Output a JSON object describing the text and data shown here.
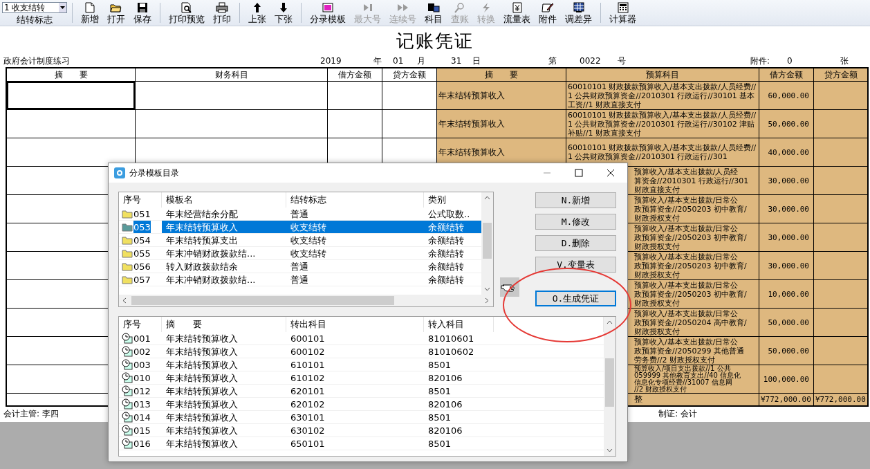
{
  "toolbar": {
    "combo": {
      "value": "1 收支结转",
      "label": "结转标志"
    },
    "groups": [
      [
        {
          "label": "新增",
          "disabled": false
        },
        {
          "label": "打开",
          "disabled": false
        },
        {
          "label": "保存",
          "disabled": false
        }
      ],
      [
        {
          "label": "打印预览",
          "disabled": false
        },
        {
          "label": "打印",
          "disabled": false
        }
      ],
      [
        {
          "label": "上张",
          "disabled": false
        },
        {
          "label": "下张",
          "disabled": false
        }
      ],
      [
        {
          "label": "分录模板",
          "disabled": false
        },
        {
          "label": "最大号",
          "disabled": true
        },
        {
          "label": "连续号",
          "disabled": true
        },
        {
          "label": "科目",
          "disabled": false
        },
        {
          "label": "查账",
          "disabled": true
        },
        {
          "label": "转换",
          "disabled": true
        },
        {
          "label": "流量表",
          "disabled": false
        },
        {
          "label": "附件",
          "disabled": false
        },
        {
          "label": "调差异",
          "disabled": false
        }
      ],
      [
        {
          "label": "计算器",
          "disabled": false
        }
      ]
    ]
  },
  "voucher": {
    "title": "记账凭证",
    "info": [
      "政府会计制度练习",
      "2019",
      "年",
      "01",
      "月",
      "31",
      "日",
      "第",
      "0022",
      "号",
      "附件:",
      "0",
      "张"
    ],
    "columns": [
      "摘　　要",
      "财务科目",
      "借方金额",
      "贷方金额",
      "摘　　要",
      "预算科目",
      "借方金额",
      "贷方金额"
    ],
    "rows": [
      {
        "focused": true,
        "summary": "年末结转预算收入",
        "budget": "60010101 财政拨款预算收入/基本支出拨款/人员经费//1 公共财政预算资金//2010301 行政运行//30101 基本工资//1 财政直接支付",
        "debit": "60,000.00"
      },
      {
        "focused": false,
        "summary": "年末结转预算收入",
        "budget": "60010101 财政拨款预算收入/基本支出拨款/人员经费//1 公共财政预算资金//2010301 行政运行//30102 津贴补贴//1 财政直接支付",
        "debit": "50,000.00"
      },
      {
        "focused": false,
        "summary": "年末结转预算收入",
        "budget": "60010101 财政拨款预算收入/基本支出拨款/人员经费//1 公共财政预算资金//2010301 行政运行//301",
        "debit": "40,000.00"
      },
      {
        "focused": false,
        "budget_fragments": [
          "预算收入/基本支出拨款/人员经",
          "算资金//2010301 行政运行//301",
          "财政直接支付"
        ],
        "debit": "30,000.00"
      },
      {
        "focused": false,
        "budget_fragments": [
          "预算收入/基本支出拨款/日常公",
          "政预算资金//2050203 初中教育/",
          "财政授权支付"
        ],
        "debit": "30,000.00"
      },
      {
        "focused": false,
        "budget_fragments": [
          "预算收入/基本支出拨款/日常公",
          "政预算资金//2050203 初中教育/",
          "财政授权支付"
        ],
        "debit": "30,000.00"
      },
      {
        "focused": false,
        "budget_fragments": [
          "预算收入/基本支出拨款/日常公",
          "政预算资金//2050203 初中教育/",
          "财政授权支付"
        ],
        "debit": "30,000.00"
      },
      {
        "focused": false,
        "budget_fragments": [
          "预算收入/基本支出拨款/日常公",
          "政预算资金//2050203 初中教育/",
          "财政授权支付"
        ],
        "debit": "10,000.00"
      },
      {
        "focused": false,
        "budget_fragments": [
          "预算收入/基本支出拨款/日常公",
          "政预算资金//2050204 高中教育/",
          "财政授权支付"
        ],
        "debit": "50,000.00"
      },
      {
        "focused": false,
        "budget_fragments": [
          "预算收入/基本支出拨款/日常公",
          "政预算资金//2050299 其他普通",
          "劳务费//2 财政授权支付"
        ],
        "debit": "50,000.00"
      },
      {
        "focused": false,
        "budget_fragments": [
          "预算收入/项目支出拨款//1 公共",
          "059999 其他教育支出//40 信息化",
          "信息化专项经费//31007 信息网",
          "//2 财政授权支付"
        ],
        "debit": "100,000.00"
      }
    ],
    "total": {
      "label": "整",
      "debit": "¥772,000.00",
      "credit": "¥772,000.00"
    },
    "footer": {
      "supervisor": "会计主管: 李四",
      "maker": "制证: 会计"
    }
  },
  "dialog": {
    "title": "分录模板目录",
    "templates": {
      "columns": [
        "序号",
        "模板名",
        "结转标志",
        "类别"
      ],
      "rows": [
        {
          "no": "051",
          "name": "年末经营结余分配",
          "flag": "普通",
          "category": "公式取数..",
          "selected": false
        },
        {
          "no": "053",
          "name": "年末结转预算收入",
          "flag": "收支结转",
          "category": "余额结转",
          "selected": true
        },
        {
          "no": "054",
          "name": "年末结转预算支出",
          "flag": "收支结转",
          "category": "余额结转",
          "selected": false
        },
        {
          "no": "055",
          "name": "年末冲销财政拨款结...",
          "flag": "收支结转",
          "category": "余额结转",
          "selected": false
        },
        {
          "no": "056",
          "name": "转入财政拨款结余",
          "flag": "普通",
          "category": "余额结转",
          "selected": false
        },
        {
          "no": "057",
          "name": "年末冲销财政拨款结...",
          "flag": "普通",
          "category": "余额结转",
          "selected": false
        }
      ]
    },
    "buttons": [
      {
        "label": "N.新增",
        "focused": false
      },
      {
        "label": "M.修改",
        "focused": false
      },
      {
        "label": "D.删除",
        "focused": false
      },
      {
        "label": "V.变量表",
        "focused": false
      },
      {
        "label": "O.生成凭证",
        "focused": true
      }
    ],
    "entries": {
      "columns": [
        "序号",
        "摘　　要",
        "转出科目",
        "转入科目"
      ],
      "rows": [
        {
          "no": "001",
          "summary": "年末结转预算收入",
          "out": "600101",
          "in": "81010601"
        },
        {
          "no": "002",
          "summary": "年末结转预算收入",
          "out": "600102",
          "in": "81010602"
        },
        {
          "no": "003",
          "summary": "年末结转预算收入",
          "out": "610101",
          "in": "8501"
        },
        {
          "no": "010",
          "summary": "年末结转预算收入",
          "out": "610102",
          "in": "820106"
        },
        {
          "no": "012",
          "summary": "年末结转预算收入",
          "out": "620101",
          "in": "8501"
        },
        {
          "no": "013",
          "summary": "年末结转预算收入",
          "out": "620102",
          "in": "820106"
        },
        {
          "no": "014",
          "summary": "年末结转预算收入",
          "out": "630101",
          "in": "8501"
        },
        {
          "no": "015",
          "summary": "年末结转预算收入",
          "out": "630102",
          "in": "820106"
        },
        {
          "no": "016",
          "summary": "年末结转预算收入",
          "out": "650101",
          "in": "8501"
        }
      ]
    }
  }
}
